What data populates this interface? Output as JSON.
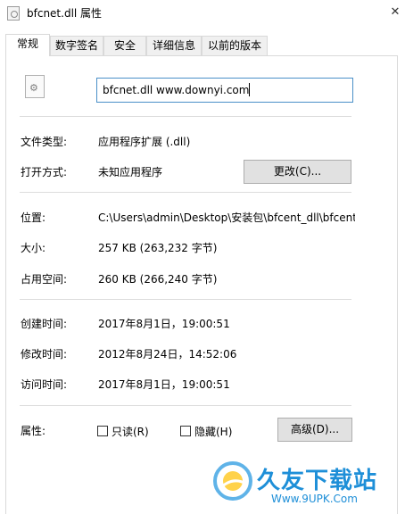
{
  "window": {
    "title": "bfcnet.dll 属性",
    "close_glyph": "✕"
  },
  "tabs": [
    {
      "label": "常规",
      "active": true
    },
    {
      "label": "数字签名",
      "active": false
    },
    {
      "label": "安全",
      "active": false
    },
    {
      "label": "详细信息",
      "active": false
    },
    {
      "label": "以前的版本",
      "active": false
    }
  ],
  "file": {
    "icon": "dll-file-gear-icon",
    "name_value": "bfcnet.dll www.downyi.com"
  },
  "info": {
    "type_label": "文件类型:",
    "type_value": "应用程序扩展 (.dll)",
    "opens_label": "打开方式:",
    "opens_value": "未知应用程序",
    "change_button": "更改(C)...",
    "location_label": "位置:",
    "location_value": "C:\\Users\\admin\\Desktop\\安装包\\bfcent_dll\\bfcent",
    "size_label": "大小:",
    "size_value": "257 KB (263,232 字节)",
    "disk_label": "占用空间:",
    "disk_value": "260 KB (266,240 字节)",
    "created_label": "创建时间:",
    "created_value": "2017年8月1日，19:00:51",
    "modified_label": "修改时间:",
    "modified_value": "2012年8月24日，14:52:06",
    "accessed_label": "访问时间:",
    "accessed_value": "2017年8月1日，19:00:51",
    "attributes_label": "属性:",
    "readonly_label": "只读(R)",
    "hidden_label": "隐藏(H)",
    "advanced_button": "高级(D)..."
  },
  "watermark": {
    "title": "久友下载站",
    "url": "Www.9UPK.Com"
  },
  "colors": {
    "input_border": "#4a90c8",
    "watermark": "#1e8fd8"
  }
}
